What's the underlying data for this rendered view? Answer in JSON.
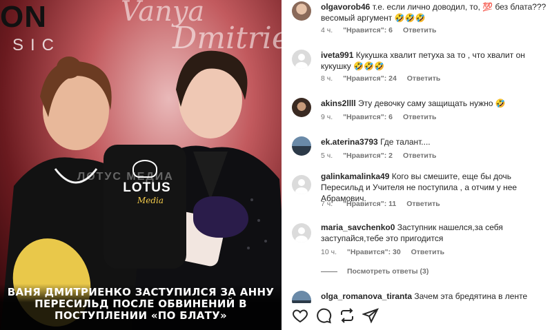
{
  "media": {
    "brand_top": "ON",
    "brand_sub": "SIC",
    "signature_1": "Vanya",
    "signature_2": "Dmitrienko",
    "mic_brand": "LOTUS",
    "mic_brand_sub": "Media",
    "watermark": "ЛОТУС МЕДИА",
    "caption": "ВАНЯ ДМИТРИЕНКО ЗАСТУПИЛСЯ ЗА АННУ ПЕРЕСИЛЬД ПОСЛЕ ОБВИНЕНИЙ В ПОСТУПЛЕНИИ «ПО БЛАТУ»"
  },
  "comments": [
    {
      "username": "olgavorob46",
      "text": "т.е. если лично доводил, то, 💯 без блата??? весомый аргумент 🤣🤣🤣",
      "time": "4 ч.",
      "likes": "\"Нравится\": 6",
      "reply": "Ответить",
      "avatar": "photo"
    },
    {
      "username": "iveta991",
      "text": "Кукушка хвалит петуха за то , что хвалит он кукушку 🤣🤣🤣",
      "time": "8 ч.",
      "likes": "\"Нравится\": 24",
      "reply": "Ответить",
      "avatar": "default"
    },
    {
      "username": "akins2llll",
      "text": "Эту девочку саму защищать нужно 🤣",
      "time": "9 ч.",
      "likes": "\"Нравится\": 6",
      "reply": "Ответить",
      "avatar": "photo"
    },
    {
      "username": "ek.aterina3793",
      "text": "Где талант....",
      "time": "5 ч.",
      "likes": "\"Нравится\": 2",
      "reply": "Ответить",
      "avatar": "photo"
    },
    {
      "username": "galinkamalinka49",
      "text": "Кого вы смешите, еще бы дочь Пересильд и Учителя не поступила , а отчим у нее Абрамович.",
      "time": "7 ч.",
      "likes": "\"Нравится\": 11",
      "reply": "Ответить",
      "avatar": "default"
    },
    {
      "username": "maria_savchenko0",
      "text": "Заступник нашелся,за себя заступайся,тебе это пригодится",
      "time": "10 ч.",
      "likes": "\"Нравится\": 30",
      "reply": "Ответить",
      "avatar": "default"
    },
    {
      "username": "olga_romanova_tiranta",
      "text": "Зачем эта бредятина в ленте",
      "time": "",
      "likes": "",
      "reply": "",
      "avatar": "photo"
    }
  ],
  "more_replies": "Посмотреть ответы (3)",
  "actions": {
    "like": "heart-icon",
    "comment": "comment-icon",
    "share": "repost-icon",
    "send": "send-icon"
  }
}
